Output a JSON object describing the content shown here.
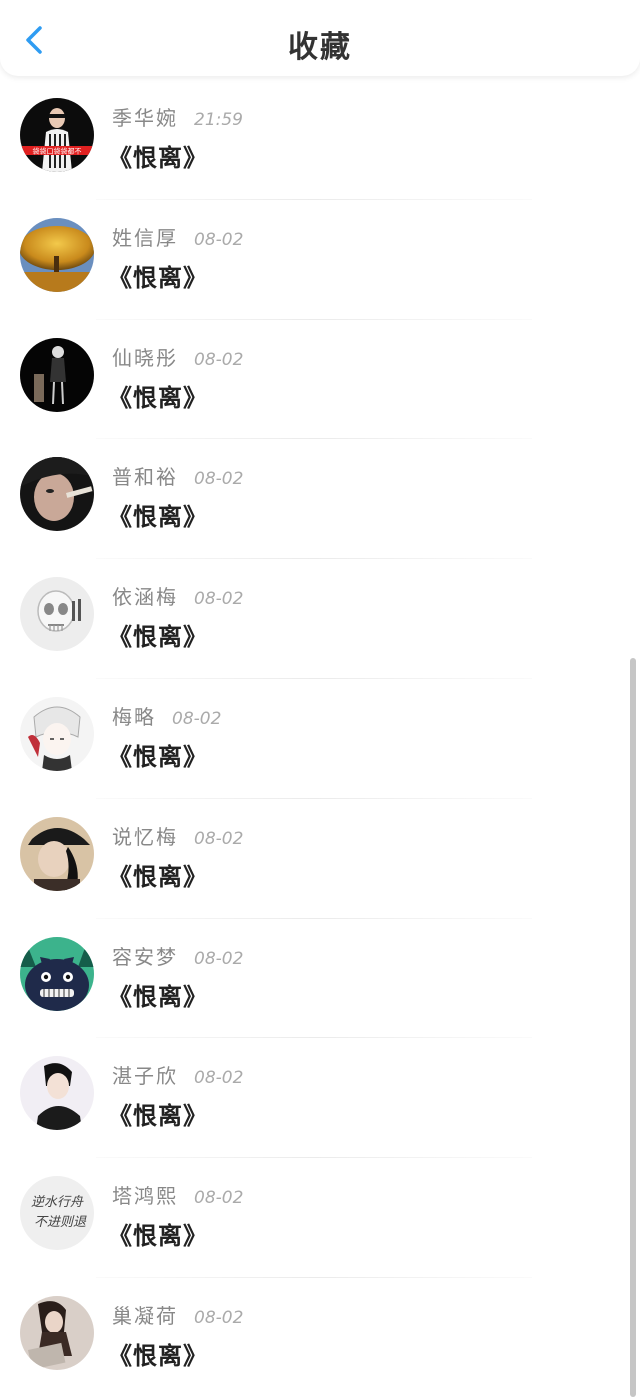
{
  "header": {
    "title": "收藏",
    "back_icon": "chevron-left-icon",
    "accent": "#2F9CF2"
  },
  "items": [
    {
      "name": "季华婉",
      "time": "21:59",
      "work": "《恨离》"
    },
    {
      "name": "姓信厚",
      "time": "08-02",
      "work": "《恨离》"
    },
    {
      "name": "仙晓彤",
      "time": "08-02",
      "work": "《恨离》"
    },
    {
      "name": "普和裕",
      "time": "08-02",
      "work": "《恨离》"
    },
    {
      "name": "依涵梅",
      "time": "08-02",
      "work": "《恨离》"
    },
    {
      "name": "梅略",
      "time": "08-02",
      "work": "《恨离》"
    },
    {
      "name": "说忆梅",
      "time": "08-02",
      "work": "《恨离》"
    },
    {
      "name": "容安梦",
      "time": "08-02",
      "work": "《恨离》"
    },
    {
      "name": "湛子欣",
      "time": "08-02",
      "work": "《恨离》"
    },
    {
      "name": "塔鸿熙",
      "time": "08-02",
      "work": "《恨离》"
    },
    {
      "name": "巢凝荷",
      "time": "08-02",
      "work": "《恨离》"
    }
  ],
  "avatar_text": {
    "a0": "袋袋口袋袋都不",
    "a9_line1": "逆水行舟",
    "a9_line2": "不进则退"
  }
}
